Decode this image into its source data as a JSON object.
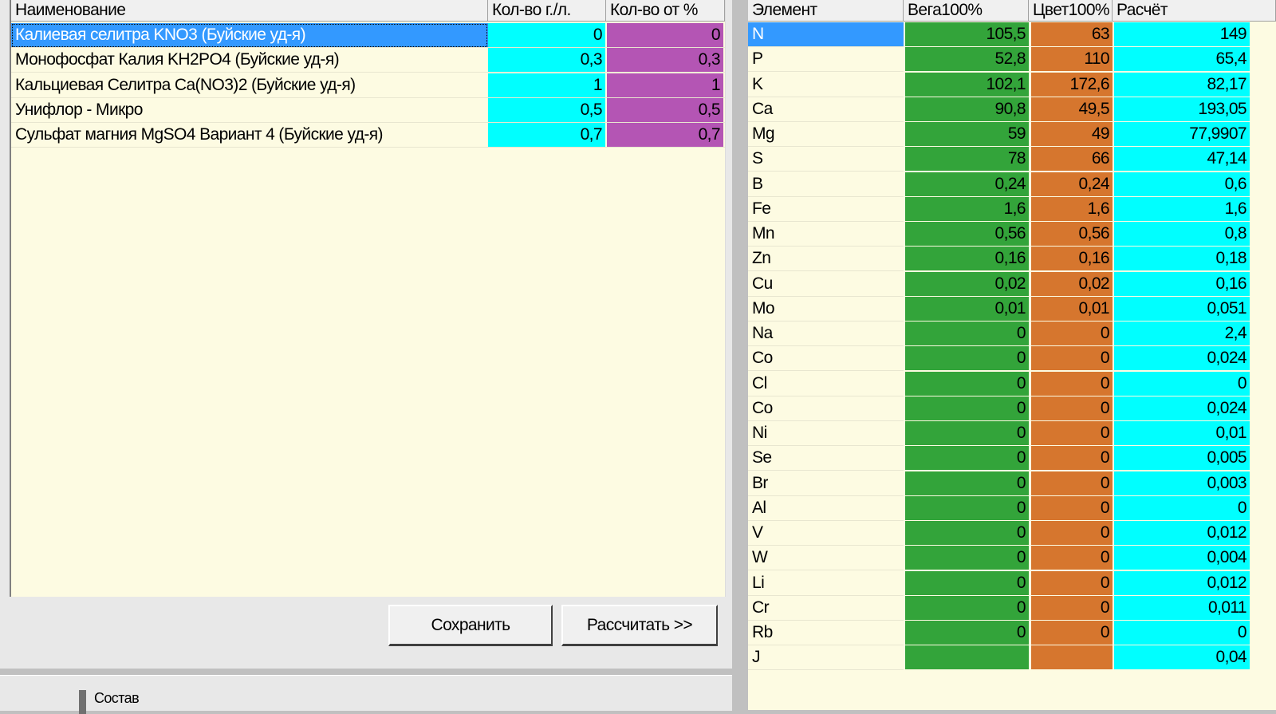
{
  "left_table": {
    "headers": {
      "name": "Наименование",
      "qty_gl": "Кол-во г./л.",
      "qty_pct": "Кол-во от %"
    },
    "rows": [
      {
        "name": "Калиевая селитра KNO3 (Буйские уд-я)",
        "qty_gl": "0",
        "qty_pct": "0"
      },
      {
        "name": "Монофосфат Калия KH2PO4 (Буйские уд-я)",
        "qty_gl": "0,3",
        "qty_pct": "0,3"
      },
      {
        "name": "Кальциевая Селитра Ca(NO3)2 (Буйские уд-я)",
        "qty_gl": "1",
        "qty_pct": "1"
      },
      {
        "name": "Унифлор - Микро",
        "qty_gl": "0,5",
        "qty_pct": "0,5"
      },
      {
        "name": "Сульфат магния MgSO4 Вариант 4 (Буйские уд-я)",
        "qty_gl": "0,7",
        "qty_pct": "0,7"
      }
    ]
  },
  "buttons": {
    "save": "Сохранить",
    "calculate": "Рассчитать >>"
  },
  "status_fragment": "Состав",
  "right_table": {
    "headers": {
      "element": "Элемент",
      "vega": "Вега100%",
      "cvet": "Цвет100%",
      "calc": "Расчёт"
    },
    "rows": [
      {
        "element": "N",
        "vega": "105,5",
        "cvet": "63",
        "calc": "149"
      },
      {
        "element": "P",
        "vega": "52,8",
        "cvet": "110",
        "calc": "65,4"
      },
      {
        "element": "K",
        "vega": "102,1",
        "cvet": "172,6",
        "calc": "82,17"
      },
      {
        "element": "Ca",
        "vega": "90,8",
        "cvet": "49,5",
        "calc": "193,05"
      },
      {
        "element": "Mg",
        "vega": "59",
        "cvet": "49",
        "calc": "77,9907"
      },
      {
        "element": "S",
        "vega": "78",
        "cvet": "66",
        "calc": "47,14"
      },
      {
        "element": "B",
        "vega": "0,24",
        "cvet": "0,24",
        "calc": "0,6"
      },
      {
        "element": "Fe",
        "vega": "1,6",
        "cvet": "1,6",
        "calc": "1,6"
      },
      {
        "element": "Mn",
        "vega": "0,56",
        "cvet": "0,56",
        "calc": "0,8"
      },
      {
        "element": "Zn",
        "vega": "0,16",
        "cvet": "0,16",
        "calc": "0,18"
      },
      {
        "element": "Cu",
        "vega": "0,02",
        "cvet": "0,02",
        "calc": "0,16"
      },
      {
        "element": "Mo",
        "vega": "0,01",
        "cvet": "0,01",
        "calc": "0,051"
      },
      {
        "element": "Na",
        "vega": "0",
        "cvet": "0",
        "calc": "2,4"
      },
      {
        "element": "Co",
        "vega": "0",
        "cvet": "0",
        "calc": "0,024"
      },
      {
        "element": "Cl",
        "vega": "0",
        "cvet": "0",
        "calc": "0"
      },
      {
        "element": "Co",
        "vega": "0",
        "cvet": "0",
        "calc": "0,024"
      },
      {
        "element": "Ni",
        "vega": "0",
        "cvet": "0",
        "calc": "0,01"
      },
      {
        "element": "Se",
        "vega": "0",
        "cvet": "0",
        "calc": "0,005"
      },
      {
        "element": "Br",
        "vega": "0",
        "cvet": "0",
        "calc": "0,003"
      },
      {
        "element": "Al",
        "vega": "0",
        "cvet": "0",
        "calc": "0"
      },
      {
        "element": "V",
        "vega": "0",
        "cvet": "0",
        "calc": "0,012"
      },
      {
        "element": "W",
        "vega": "0",
        "cvet": "0",
        "calc": "0,004"
      },
      {
        "element": "Li",
        "vega": "0",
        "cvet": "0",
        "calc": "0,012"
      },
      {
        "element": "Cr",
        "vega": "0",
        "cvet": "0",
        "calc": "0,011"
      },
      {
        "element": "Rb",
        "vega": "0",
        "cvet": "0",
        "calc": "0"
      },
      {
        "element": "J",
        "vega": "",
        "cvet": "",
        "calc": "0,04"
      }
    ]
  },
  "colors": {
    "grid_background": "#fdfbe2",
    "selection": "#3399ff",
    "qty_gl_column": "#00ffff",
    "qty_pct_column": "#b455b4",
    "vega_column": "#33a43a",
    "cvet_column": "#d6762e",
    "calc_column": "#00ffff"
  }
}
